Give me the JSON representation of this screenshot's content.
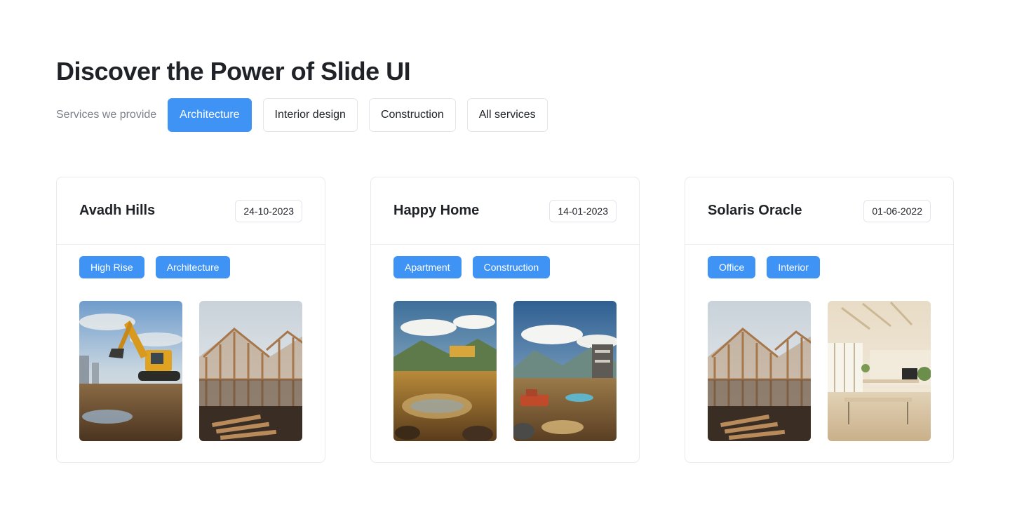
{
  "header": {
    "title": "Discover the Power of Slide UI"
  },
  "filters": {
    "label": "Services we provide",
    "options": [
      {
        "label": "Architecture",
        "active": true
      },
      {
        "label": "Interior design",
        "active": false
      },
      {
        "label": "Construction",
        "active": false
      },
      {
        "label": "All services",
        "active": false
      }
    ]
  },
  "colors": {
    "accent": "#3f93f5",
    "border": "#e3e6ea",
    "text": "#1f2328",
    "muted": "#7b818a"
  },
  "projects": [
    {
      "name": "Avadh Hills",
      "date": "24-10-2023",
      "tags": [
        "High Rise",
        "Architecture"
      ],
      "images": [
        "excavator-photo",
        "timber-frame-photo"
      ]
    },
    {
      "name": "Happy Home",
      "date": "14-01-2023",
      "tags": [
        "Apartment",
        "Construction"
      ],
      "images": [
        "quarry-landscape-photo",
        "construction-site-photo"
      ]
    },
    {
      "name": "Solaris Oracle",
      "date": "01-06-2022",
      "tags": [
        "Office",
        "Interior"
      ],
      "images": [
        "timber-frame-photo",
        "office-interior-photo"
      ]
    }
  ]
}
